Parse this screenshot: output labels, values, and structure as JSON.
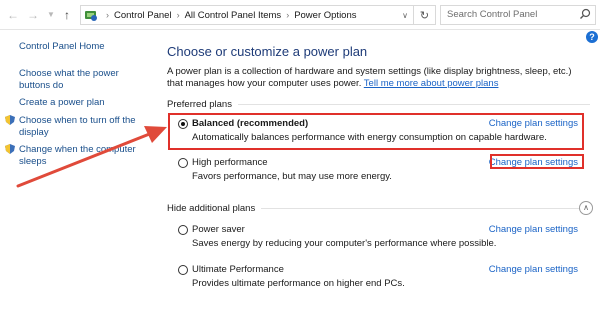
{
  "address_bar": {
    "crumbs": [
      "Control Panel",
      "All Control Panel Items",
      "Power Options"
    ],
    "search_placeholder": "Search Control Panel"
  },
  "left_pane": {
    "home": "Control Panel Home",
    "links": [
      "Choose what the power buttons do",
      "Create a power plan",
      "Choose when to turn off the display",
      "Change when the computer sleeps"
    ]
  },
  "main": {
    "title": "Choose or customize a power plan",
    "description": "A power plan is a collection of hardware and system settings (like display brightness, sleep, etc.) that manages how your computer uses power.",
    "tell_more": "Tell me more about power plans",
    "preferred_header": "Preferred plans",
    "hidden_header": "Hide additional plans",
    "change_link": "Change plan settings",
    "preferred_plans": [
      {
        "name": "Balanced (recommended)",
        "desc": "Automatically balances performance with energy consumption on capable hardware.",
        "selected": true
      },
      {
        "name": "High performance",
        "desc": "Favors performance, but may use more energy.",
        "selected": false
      }
    ],
    "additional_plans": [
      {
        "name": "Power saver",
        "desc": "Saves energy by reducing your computer's performance where possible.",
        "selected": false
      },
      {
        "name": "Ultimate Performance",
        "desc": "Provides ultimate performance on higher end PCs.",
        "selected": false
      }
    ]
  },
  "colors": {
    "link": "#1a63c6",
    "title": "#1e3b78",
    "highlight": "#e0302a"
  }
}
